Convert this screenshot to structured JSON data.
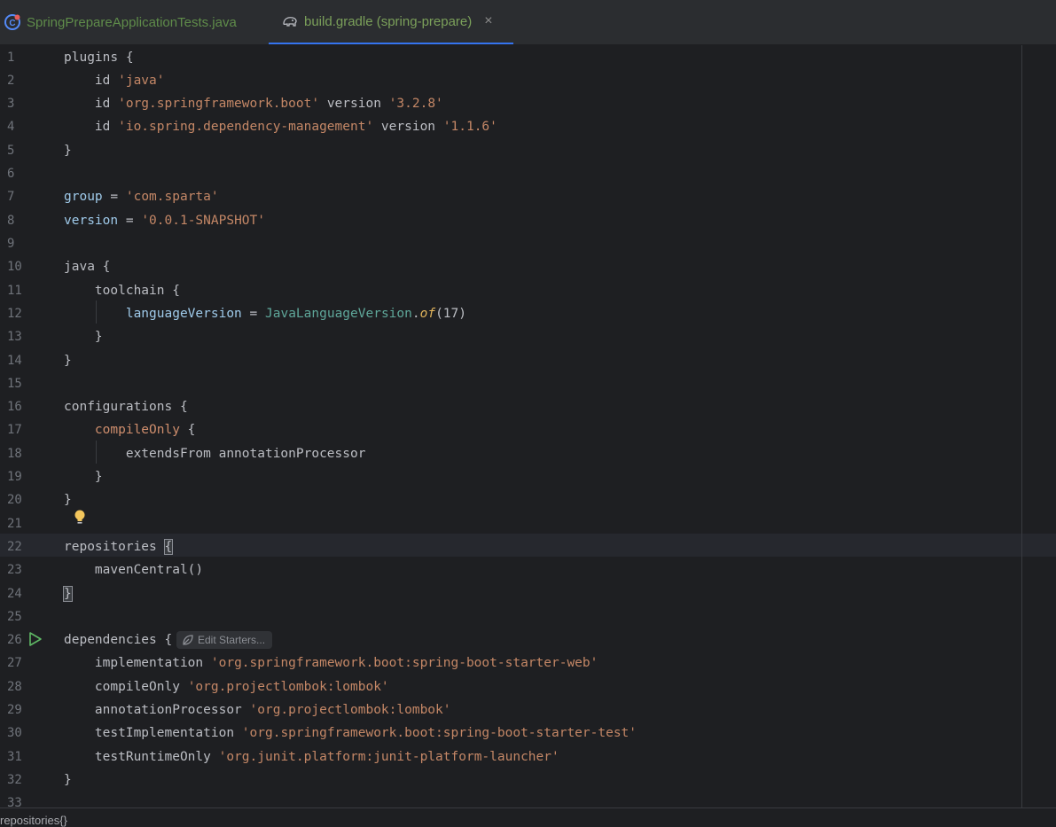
{
  "tabs": [
    {
      "label": "SpringPrepareApplicationTests.java",
      "icon": "java-test-class-icon"
    },
    {
      "label": "build.gradle (spring-prepare)",
      "icon": "gradle-elephant-icon",
      "close": "×"
    }
  ],
  "editor": {
    "lines": [
      {
        "n": "1"
      },
      {
        "n": "2"
      },
      {
        "n": "3"
      },
      {
        "n": "4"
      },
      {
        "n": "5"
      },
      {
        "n": "6"
      },
      {
        "n": "7"
      },
      {
        "n": "8"
      },
      {
        "n": "9"
      },
      {
        "n": "10"
      },
      {
        "n": "11"
      },
      {
        "n": "12"
      },
      {
        "n": "13"
      },
      {
        "n": "14"
      },
      {
        "n": "15"
      },
      {
        "n": "16"
      },
      {
        "n": "17"
      },
      {
        "n": "18"
      },
      {
        "n": "19"
      },
      {
        "n": "20"
      },
      {
        "n": "21"
      },
      {
        "n": "22"
      },
      {
        "n": "23"
      },
      {
        "n": "24"
      },
      {
        "n": "25"
      },
      {
        "n": "26"
      },
      {
        "n": "27"
      },
      {
        "n": "28"
      },
      {
        "n": "29"
      },
      {
        "n": "30"
      },
      {
        "n": "31"
      },
      {
        "n": "32"
      },
      {
        "n": "33"
      }
    ],
    "code": {
      "l1": "plugins {",
      "l2a": "    id ",
      "l2b": "'java'",
      "l3a": "    id ",
      "l3b": "'org.springframework.boot'",
      "l3c": " version ",
      "l3d": "'3.2.8'",
      "l4a": "    id ",
      "l4b": "'io.spring.dependency-management'",
      "l4c": " version ",
      "l4d": "'1.1.6'",
      "l5": "}",
      "l7a": "group",
      "l7b": " = ",
      "l7c": "'com.sparta'",
      "l8a": "version",
      "l8b": " = ",
      "l8c": "'0.0.1-SNAPSHOT'",
      "l10": "java {",
      "l11": "    toolchain {",
      "l12a": "        ",
      "l12b": "languageVersion",
      "l12c": " = ",
      "l12d": "JavaLanguageVersion",
      "l12e": ".",
      "l12f": "of",
      "l12g": "(17)",
      "l13": "    }",
      "l14": "}",
      "l16": "configurations {",
      "l17a": "    ",
      "l17b": "compileOnly",
      "l17c": " {",
      "l18": "        extendsFrom annotationProcessor",
      "l19": "    }",
      "l20": "}",
      "l22a": "repositories ",
      "l22b": "{",
      "l23": "    mavenCentral()",
      "l24": "}",
      "l26": "dependencies {",
      "l27a": "    implementation ",
      "l27b": "'org.springframework.boot:spring-boot-starter-web'",
      "l28a": "    compileOnly ",
      "l28b": "'org.projectlombok:lombok'",
      "l29a": "    annotationProcessor ",
      "l29b": "'org.projectlombok:lombok'",
      "l30a": "    testImplementation ",
      "l30b": "'org.springframework.boot:spring-boot-starter-test'",
      "l31a": "    testRuntimeOnly ",
      "l31b": "'org.junit.platform:junit-platform-launcher'",
      "l32": "}"
    },
    "hint_label": "Edit Starters...",
    "hint_icon": "spring-leaf-icon",
    "run_icon": "run-gutter-icon",
    "bulb_icon": "lightbulb-icon",
    "current_line": "22"
  },
  "status": {
    "breadcrumb": "repositories{}"
  },
  "colors": {
    "accent": "#3574f0",
    "string": "#c48766",
    "property": "#9fcaea",
    "class": "#5fa79a"
  }
}
